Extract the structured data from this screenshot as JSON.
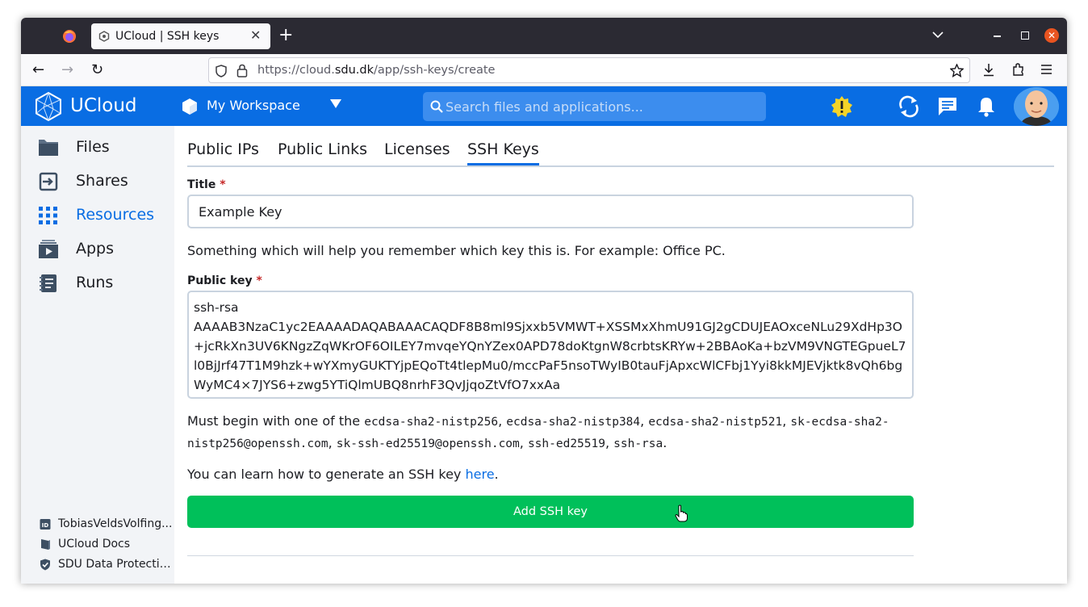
{
  "browser": {
    "tab_title": "UCloud | SSH keys",
    "url_prefix": "https://cloud.",
    "url_domain": "sdu.dk",
    "url_path": "/app/ssh-keys/create",
    "close_tab": "✕",
    "new_tab": "+",
    "back": "←",
    "forward": "→",
    "reload": "↻"
  },
  "header": {
    "brand": "UCloud",
    "workspace": "My Workspace",
    "search_placeholder": "Search files and applications...",
    "brand_color": "#096de3"
  },
  "sidebar": {
    "items": [
      {
        "label": "Files",
        "icon": "folder-icon"
      },
      {
        "label": "Shares",
        "icon": "share-icon"
      },
      {
        "label": "Resources",
        "icon": "grid-icon",
        "active": true
      },
      {
        "label": "Apps",
        "icon": "apps-icon"
      },
      {
        "label": "Runs",
        "icon": "runs-icon"
      }
    ],
    "footer": [
      {
        "label": "TobiasVeldsVolfing...",
        "icon": "id-icon"
      },
      {
        "label": "UCloud Docs",
        "icon": "book-icon"
      },
      {
        "label": "SDU Data Protection",
        "icon": "shield-icon"
      }
    ]
  },
  "main": {
    "tabs": [
      "Public IPs",
      "Public Links",
      "Licenses",
      "SSH Keys"
    ],
    "active_tab": "SSH Keys",
    "title_label": "Title",
    "title_value": "Example Key",
    "title_help": "Something which will help you remember which key this is. For example: Office PC.",
    "key_label": "Public key",
    "key_value": "ssh-rsa\nAAAAB3NzaC1yc2EAAAADAQABAAACAQDF8B8ml9Sjxxb5VMWT+XSSMxXhmU91GJ2gCDUJEAOxceNLu29XdHp3O+jcRkXn3UV6KNgzZqWKrOF6OILEY7mvqeYQnYZex0APD78doKtgnW8crbtsKRYw+2BBAoKa+bzVM9VNGTEGpueL7l0BjJrf47T1M9hzk+wYXmyGUKTYjpEQoTt4tlepMu0/mccPaF5nsoTWyIB0tauFjApxcWlCFbj1Yyi8kkMJEVjktk8vQh6bgWyMC4×7JYS6+zwg5YTiQlmUBQ8nrhF3QvJjqoZtVfO7xxAa",
    "required_mark": "*",
    "begin_prefix": "Must begin with one of the ",
    "key_types": [
      "ecdsa-sha2-nistp256",
      "ecdsa-sha2-nistp384",
      "ecdsa-sha2-nistp521",
      "sk-ecdsa-sha2-nistp256@openssh.com",
      "sk-ssh-ed25519@openssh.com",
      "ssh-ed25519",
      "ssh-rsa"
    ],
    "learn_prefix": "You can learn how to generate an SSH key ",
    "learn_link": "here",
    "learn_suffix": ".",
    "submit_label": "Add SSH key",
    "submit_color": "#00c05a"
  }
}
